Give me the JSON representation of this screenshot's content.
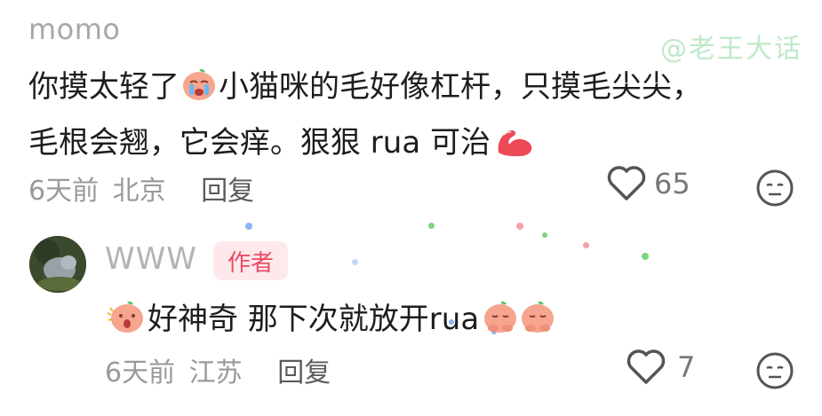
{
  "watermark": "@老王大话",
  "comment": {
    "username": "momo",
    "text_part1": "你摸太轻了",
    "text_part2": "小猫咪的毛好像杠杆，只摸毛尖尖，",
    "text_part3": "毛根会翘，它会痒。狠狠 rua 可治",
    "emojis": [
      "crying-face-emoji",
      "flexed-arm-emoji"
    ],
    "time": "6天前",
    "location": "北京",
    "reply_label": "回复",
    "like_count": "65"
  },
  "reply": {
    "username": "WWW",
    "badge": "作者",
    "text": "好神奇 那下次就放开rua",
    "emojis": [
      "surprised-face-emoji",
      "pleading-face-emoji",
      "pleading-face-emoji"
    ],
    "time": "6天前",
    "location": "江苏",
    "reply_label": "回复",
    "like_count": "7"
  },
  "colors": {
    "badge_bg": "#fde9ec",
    "badge_text": "#ee4a63",
    "watermark": "#bfe9c8"
  }
}
